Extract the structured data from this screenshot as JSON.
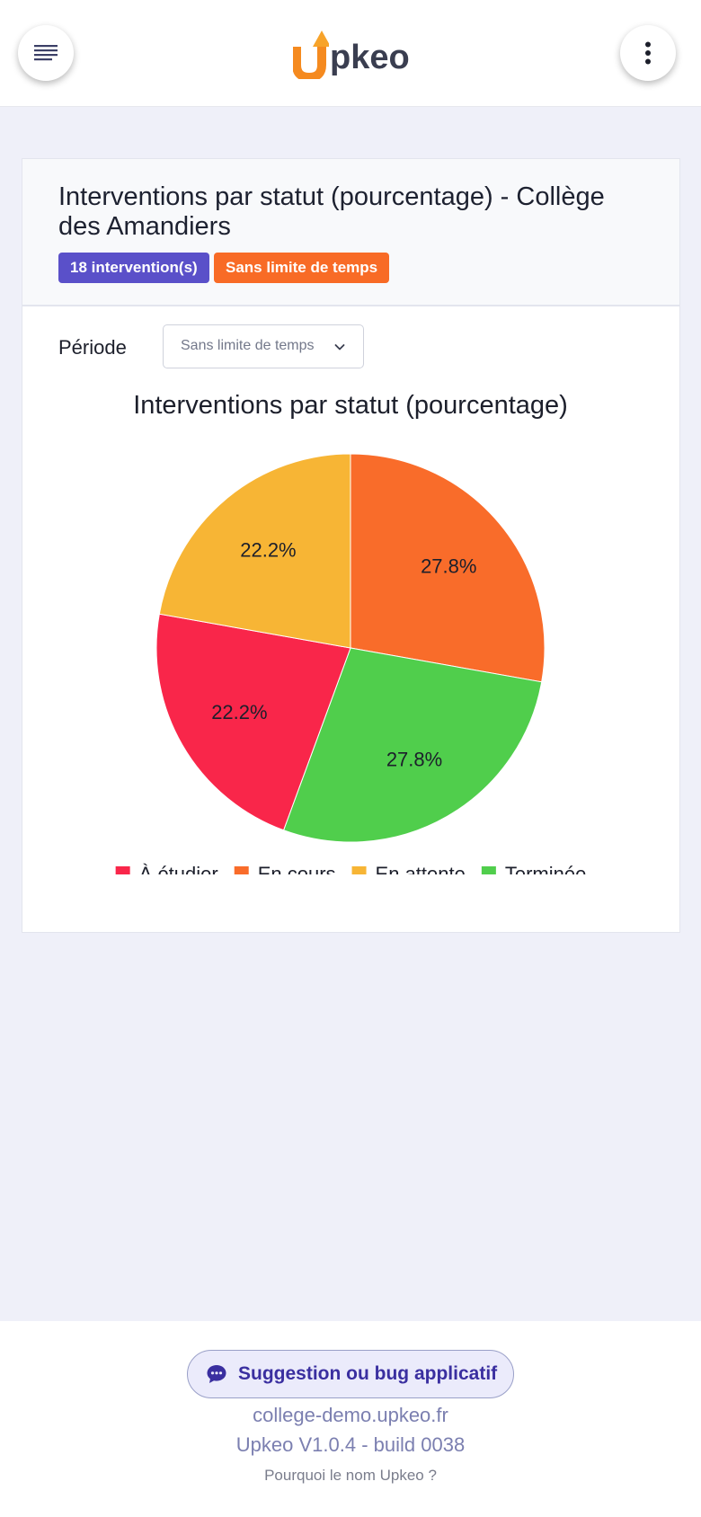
{
  "app": {
    "brand": "pkeo",
    "brand_colors": {
      "u_orange": "#f58a1f",
      "text": "#3a3e50"
    }
  },
  "header": {
    "menu_icon": "hamburger-menu-icon",
    "more_icon": "vertical-dots-icon"
  },
  "card": {
    "title": "Interventions par statut (pourcentage) - Collège des Amandiers",
    "badge_count": "18 intervention(s)",
    "badge_period": "Sans limite de temps",
    "badge_colors": {
      "count": "#5a50c9",
      "period": "#f86b26"
    }
  },
  "filter": {
    "label": "Période",
    "selected": "Sans limite de temps"
  },
  "chart_data": {
    "type": "pie",
    "title": "Interventions par statut (pourcentage)",
    "unit": "%",
    "legend_position": "bottom",
    "slices": [
      {
        "label": "En cours",
        "value": 27.8,
        "display": "27.8%",
        "color": "#f96c2a"
      },
      {
        "label": "Terminée",
        "value": 27.8,
        "display": "27.8%",
        "color": "#50ce4c"
      },
      {
        "label": "À étudier",
        "value": 22.2,
        "display": "22.2%",
        "color": "#f9264a"
      },
      {
        "label": "En attente",
        "value": 22.2,
        "display": "22.2%",
        "color": "#f7b535"
      }
    ],
    "legend": [
      {
        "label": "À étudier",
        "color": "#f9264a"
      },
      {
        "label": "En cours",
        "color": "#f96c2a"
      },
      {
        "label": "En attente",
        "color": "#f7b535"
      },
      {
        "label": "Terminée",
        "color": "#50ce4c"
      }
    ]
  },
  "footer": {
    "feedback_label": "Suggestion ou bug applicatif",
    "feedback_icon": "chat-bubble-icon",
    "domain": "college-demo.upkeo.fr",
    "version": "Upkeo V1.0.4 - build 0038",
    "why_name": "Pourquoi le nom Upkeo ?"
  }
}
